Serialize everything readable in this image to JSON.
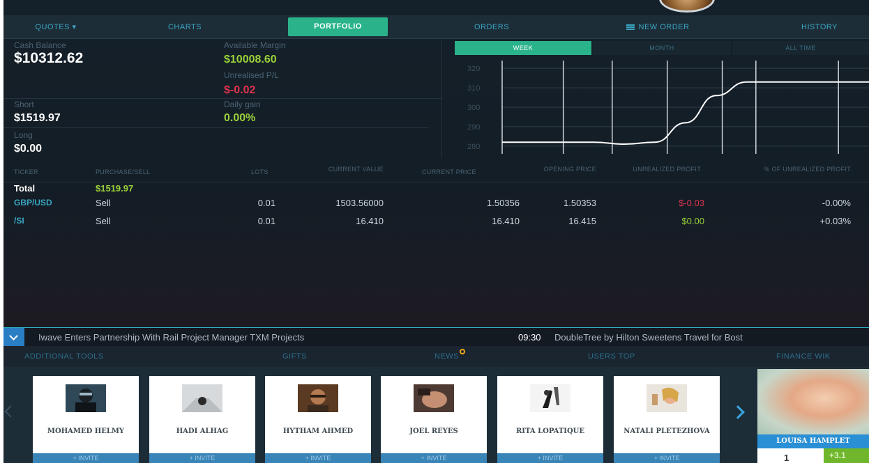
{
  "nav": {
    "quotes": "QUOTES ▾",
    "charts": "CHARTS",
    "portfolio": "PORTFOLIO",
    "orders": "ORDERS",
    "new_order": "NEW ORDER",
    "history": "HISTORY"
  },
  "summary": {
    "cash_balance_label": "Cash Balance",
    "cash_balance": "$10312.62",
    "available_margin_label": "Available Margin",
    "available_margin": "$10008.60",
    "unrealised_label": "Unrealised P/L",
    "unrealised": "$-0.02",
    "short_label": "Short",
    "short": "$1519.97",
    "daily_gain_label": "Daily gain",
    "daily_gain": "0.00%",
    "long_label": "Long",
    "long": "$0.00"
  },
  "chart_tabs": {
    "week": "WEEK",
    "month": "MONTH",
    "all_time": "ALL TIME"
  },
  "chart_data": {
    "type": "line",
    "y_ticks": [
      "320",
      "310",
      "300",
      "290",
      "280"
    ],
    "ylim": [
      276,
      324
    ],
    "x": [
      0,
      1,
      2,
      3,
      4,
      5,
      6,
      7,
      8,
      9,
      10,
      11,
      12
    ],
    "values": [
      282,
      282,
      282,
      282,
      281,
      282,
      292,
      306,
      313,
      313,
      313,
      313,
      313
    ],
    "grid": true
  },
  "table": {
    "headers": {
      "ticker": "TICKER",
      "purchase_sell": "PURCHASE/SELL",
      "lots": "LOTS",
      "current_value": "CURRENT VALUE",
      "current_price": "CURRENT PRICE",
      "opening_price": "OPENING PRICE",
      "unrealized_profit": "UNREALIZED PROFIT",
      "pct_unrealized": "% OF UNREALIZED PROFIT"
    },
    "total_label": "Total",
    "total_value": "$1519.97",
    "rows": [
      {
        "ticker": "GBP/USD",
        "side": "Sell",
        "lots": "0.01",
        "current_value": "1503.56000",
        "current_price": "1.50356",
        "opening_price": "1.50353",
        "unrealized": "$-0.03",
        "pct": "-0.00%"
      },
      {
        "ticker": "/SI",
        "side": "Sell",
        "lots": "0.01",
        "current_value": "16.410",
        "current_price": "16.410",
        "opening_price": "16.415",
        "unrealized": "$0.00",
        "pct": "+0.03%"
      }
    ]
  },
  "news": {
    "headline_1": "Iwave Enters Partnership With Rail Project Manager TXM Projects",
    "time_2": "09:30",
    "headline_2": "DoubleTree by Hilton Sweetens Travel for Bost"
  },
  "tools": {
    "additional_tools": "ADDITIONAL TOOLS",
    "gifts": "GIFTS",
    "news": "NEWS",
    "users_top": "USERS TOP",
    "finance_wiki": "FINANCE WIK"
  },
  "users": [
    {
      "name": "MOHAMED HELMY",
      "invite": "+ INVITE"
    },
    {
      "name": "HADI ALHAG",
      "invite": "+ INVITE"
    },
    {
      "name": "HYTHAM AHMED",
      "invite": "+ INVITE"
    },
    {
      "name": "JOEL REYES",
      "invite": "+ INVITE"
    },
    {
      "name": "RITA LOPATIQUE",
      "invite": "+ INVITE"
    },
    {
      "name": "NATALI PLETEZHOVA",
      "invite": "+ INVITE"
    }
  ],
  "featured_user": {
    "name": "LOUISA HAMPLET",
    "rank": "1",
    "gain": "+3.1"
  },
  "colors": {
    "accent_green": "#2ab38a",
    "accent_blue": "#3aa6c2",
    "profit_green": "#9bd13a",
    "loss_red": "#e0334f"
  }
}
